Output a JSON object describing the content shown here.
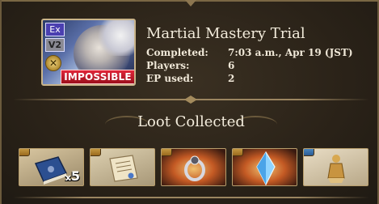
{
  "quest": {
    "badges": {
      "ex": "Ex",
      "version": "V2"
    },
    "difficulty": "IMPOSSIBLE",
    "title": "Martial Mastery Trial",
    "info": [
      {
        "label": "Completed:",
        "value": "7:03 a.m., Apr 19 (JST)"
      },
      {
        "label": "Players:",
        "value": "6"
      },
      {
        "label": "EP used:",
        "value": "2"
      }
    ]
  },
  "loot": {
    "heading": "Loot Collected",
    "items": [
      {
        "icon": "blue-tome-icon",
        "chest": "gold",
        "qty_prefix": "x",
        "qty_value": "5"
      },
      {
        "icon": "scroll-parchment-icon",
        "chest": "gold",
        "qty_prefix": "",
        "qty_value": ""
      },
      {
        "icon": "silver-ring-icon",
        "chest": "gold",
        "qty_prefix": "",
        "qty_value": ""
      },
      {
        "icon": "blue-crystal-icon",
        "chest": "gold",
        "qty_prefix": "",
        "qty_value": ""
      },
      {
        "icon": "golden-figure-icon",
        "chest": "blue",
        "qty_prefix": "",
        "qty_value": ""
      }
    ]
  },
  "colors": {
    "panel_bg": "#2c2419",
    "frame_gold": "#b89e6c",
    "impossible_red": "#c81a2a",
    "text_cream": "#f3ecdc"
  }
}
